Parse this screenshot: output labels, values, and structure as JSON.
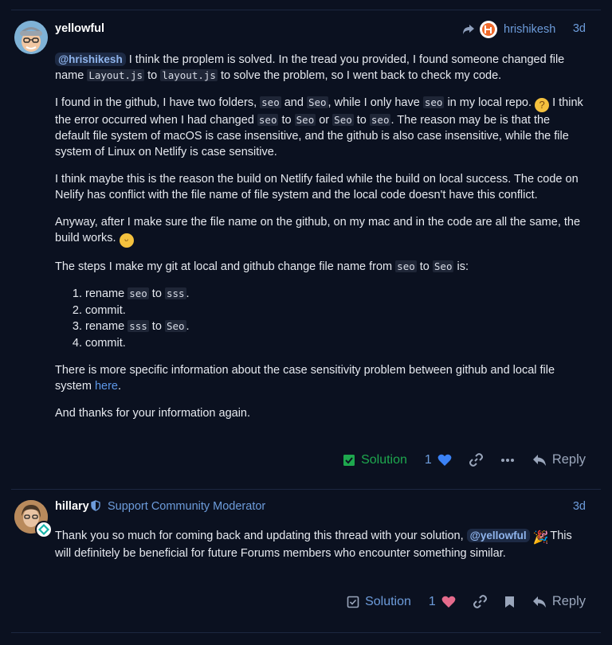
{
  "post1": {
    "username": "yellowful",
    "reply_to_name": "hrishikesh",
    "date": "3d",
    "p1": {
      "mention": "@hrishikesh",
      "t1": " I think the proplem is solved. In the tread you provided, I found someone changed file name ",
      "c1": "Layout.js",
      "t2": " to ",
      "c2": "layout.js",
      "t3": " to solve the problem, so I went back to check my code."
    },
    "p2": {
      "t1": "I found in the github, I have two folders, ",
      "c1": "seo",
      "t2": " and ",
      "c2": "Seo",
      "t3": ", while I only have ",
      "c3": "seo",
      "t4": " in my local repo. ",
      "t5": " I think the error occurred when I had changed ",
      "c4": "seo",
      "t6": " to ",
      "c5": "Seo",
      "t7": " or ",
      "c6": "Seo",
      "t8": " to ",
      "c7": "seo",
      "t9": ". The reason may be is that the default file system of macOS is case insensitive, and the github is also case insensitive, while the file system of Linux on Netlify is case sensitive."
    },
    "p3": "I think maybe this is the reason the build on Netlify failed while the build on local success. The code on Nelify has conflict with the file name of file system and the local code doesn't have this conflict.",
    "p4": {
      "t1": "Anyway, after I make sure the file name on the github, on my mac and in the code are all the same, the build works. "
    },
    "p5": {
      "t1": "The steps I make my git at local and github change file name from ",
      "c1": "seo",
      "t2": " to ",
      "c2": "Seo",
      "t3": " is:"
    },
    "steps": {
      "s1a": "rename ",
      "s1c1": "seo",
      "s1b": " to ",
      "s1c2": "sss",
      "s1d": ".",
      "s2": "commit.",
      "s3a": "rename ",
      "s3c1": "sss",
      "s3b": " to ",
      "s3c2": "Seo",
      "s3d": ".",
      "s4": "commit."
    },
    "p6": {
      "t1": "There is more specific information about the case sensitivity problem between github and local file system ",
      "link": "here",
      "t2": "."
    },
    "p7": "And thanks for your information again.",
    "actions": {
      "solution_label": "Solution",
      "like_count": "1",
      "reply_label": "Reply"
    }
  },
  "post2": {
    "username": "hillary",
    "title": "Support Community Moderator",
    "date": "3d",
    "p1": {
      "t1": "Thank you so much for coming back and updating this thread with your solution, ",
      "mention": "@yellowful",
      "t2": " This will definitely be beneficial for future Forums members who encounter something similar."
    },
    "actions": {
      "solution_label": "Solution",
      "like_count": "1",
      "reply_label": "Reply"
    }
  },
  "colors": {
    "background": "#0b1120",
    "link": "#6d9cdb",
    "solution_green": "#1ea84e",
    "heart_blue": "#3b82f6",
    "heart_pink": "#e56b8c"
  }
}
